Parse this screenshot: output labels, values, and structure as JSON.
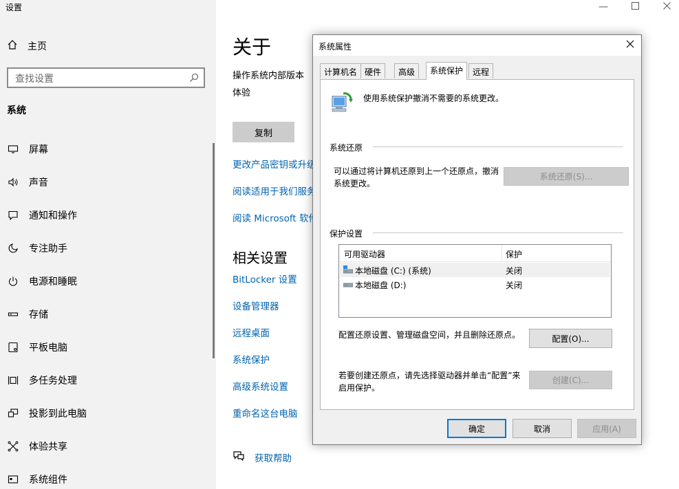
{
  "settings": {
    "window_title": "设置",
    "home_label": "主页",
    "search_placeholder": "查找设置",
    "section_title": "系统",
    "nav": [
      {
        "label": "屏幕",
        "icon": "monitor-icon"
      },
      {
        "label": "声音",
        "icon": "speaker-icon"
      },
      {
        "label": "通知和操作",
        "icon": "notification-icon"
      },
      {
        "label": "专注助手",
        "icon": "moon-icon"
      },
      {
        "label": "电源和睡眠",
        "icon": "power-icon"
      },
      {
        "label": "存储",
        "icon": "storage-icon"
      },
      {
        "label": "平板电脑",
        "icon": "tablet-icon"
      },
      {
        "label": "多任务处理",
        "icon": "multitask-icon"
      },
      {
        "label": "投影到此电脑",
        "icon": "project-icon"
      },
      {
        "label": "体验共享",
        "icon": "share-icon"
      },
      {
        "label": "系统组件",
        "icon": "components-icon"
      }
    ]
  },
  "about": {
    "title": "关于",
    "os_build_label": "操作系统内部版本",
    "experience_label": "体验",
    "copy_label": "复制",
    "links": [
      "更改产品密钥或升级",
      "阅读适用于我们服务",
      "阅读 Microsoft 软件"
    ],
    "related_title": "相关设置",
    "related_links": [
      "BitLocker 设置",
      "设备管理器",
      "远程桌面",
      "系统保护",
      "高级系统设置",
      "重命名这台电脑"
    ],
    "help_label": "获取帮助"
  },
  "dialog": {
    "title": "系统属性",
    "tabs": [
      "计算机名",
      "硬件",
      "高级",
      "系统保护",
      "远程"
    ],
    "active_tab": "系统保护",
    "description": "使用系统保护撤消不需要的系统更改。",
    "restore_group": "系统还原",
    "restore_text_1": "可以通过将计算机还原到上一个还原点，撤消",
    "restore_text_2": "系统更改。",
    "restore_button": "系统还原(S)...",
    "protection_group": "保护设置",
    "columns": [
      "可用驱动器",
      "保护"
    ],
    "drives": [
      {
        "name": "本地磁盘 (C:) (系统)",
        "protection": "关闭",
        "selected": true
      },
      {
        "name": "本地磁盘 (D:)",
        "protection": "关闭",
        "selected": false
      }
    ],
    "configure_text": "配置还原设置、管理磁盘空间，并且删除还原点。",
    "configure_button": "配置(O)...",
    "create_text_1": "若要创建还原点，请先选择驱动器并单击“配置”来",
    "create_text_2": "启用保护。",
    "create_button": "创建(C)...",
    "ok_button": "确定",
    "cancel_button": "取消",
    "apply_button": "应用(A)"
  }
}
